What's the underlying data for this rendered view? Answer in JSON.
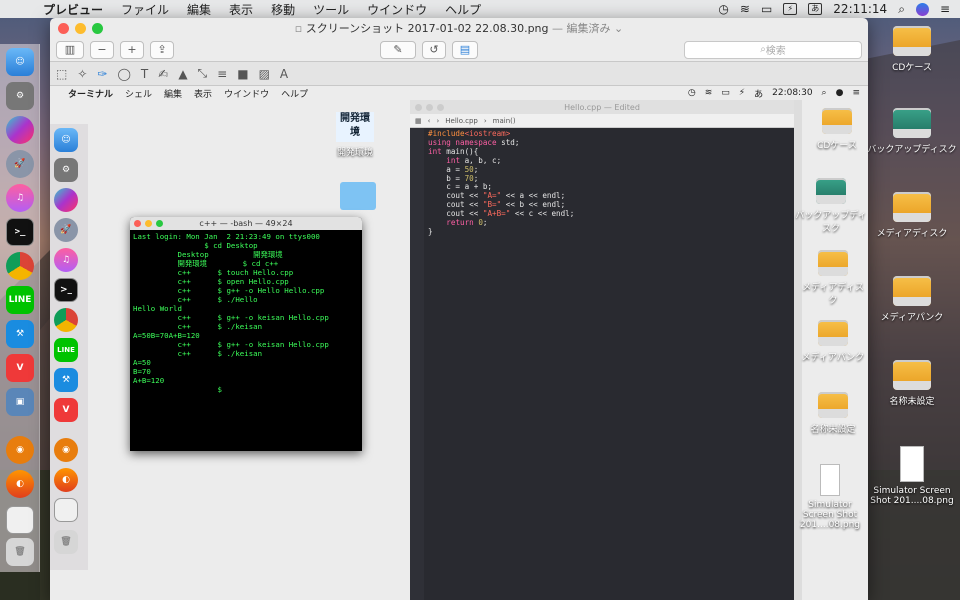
{
  "menubar": {
    "app": "プレビュー",
    "items": [
      "ファイル",
      "編集",
      "表示",
      "移動",
      "ツール",
      "ウインドウ",
      "ヘルプ"
    ],
    "battery": "⚡",
    "ime": "あ",
    "clock": "22:11:14"
  },
  "preview": {
    "title": "スクリーンショット 2017-01-02 22.08.30.png",
    "edited": "— 編集済み ⌄",
    "search_placeholder": "検索"
  },
  "inner_menubar": {
    "app": "ターミナル",
    "items": [
      "シェル",
      "編集",
      "表示",
      "ウインドウ",
      "ヘルプ"
    ],
    "battery": "⚡",
    "ime": "あ",
    "clock": "22:08:30"
  },
  "terminal": {
    "title": "c++ — -bash — 49×24",
    "lines": [
      "Last login: Mon Jan  2 21:23:49 on ttys000",
      "                $ cd Desktop",
      "          Desktop          開発環境",
      "          開発環境        $ cd c++",
      "          c++      $ touch Hello.cpp",
      "          c++      $ open Hello.cpp",
      "          c++      $ g++ -o Hello Hello.cpp",
      "          c++      $ ./Hello",
      "Hello World",
      "          c++      $ g++ -o keisan Hello.cpp",
      "          c++      $ ./keisan",
      "A=50B=70A+B=120",
      "          c++      $ g++ -o keisan Hello.cpp",
      "          c++      $ ./keisan",
      "A=50",
      "B=70",
      "A+B=120",
      "                   $"
    ]
  },
  "xcode": {
    "title": "Hello.cpp — Edited",
    "jump": [
      "Hello.cpp",
      "main()"
    ]
  },
  "inner_desktop": {
    "folder_label": "開発環境",
    "folder_caption": "開発環境"
  },
  "inner_right_icons": [
    "CDケース",
    "バックアップディスク",
    "メディアディスク",
    "メディアパンク",
    "名称未設定",
    "Simulator Screen Shot 201....08.png"
  ],
  "desktop_icons": [
    "CDケース",
    "バックアップディスク",
    "メディアディスク",
    "メディアパンク",
    "名称未設定",
    "Simulator Screen Shot 201....08.png"
  ],
  "dock_icons": [
    "finder-icon",
    "system-preferences-icon",
    "siri-icon",
    "launchpad-icon",
    "itunes-icon",
    "terminal-icon",
    "chrome-icon",
    "line-icon",
    "xcode-icon",
    "vivaldi-icon",
    "preview-icon",
    "blender-icon",
    "firefox-icon",
    "screenshot-icon",
    "trash-icon"
  ],
  "line_label": "LINE"
}
